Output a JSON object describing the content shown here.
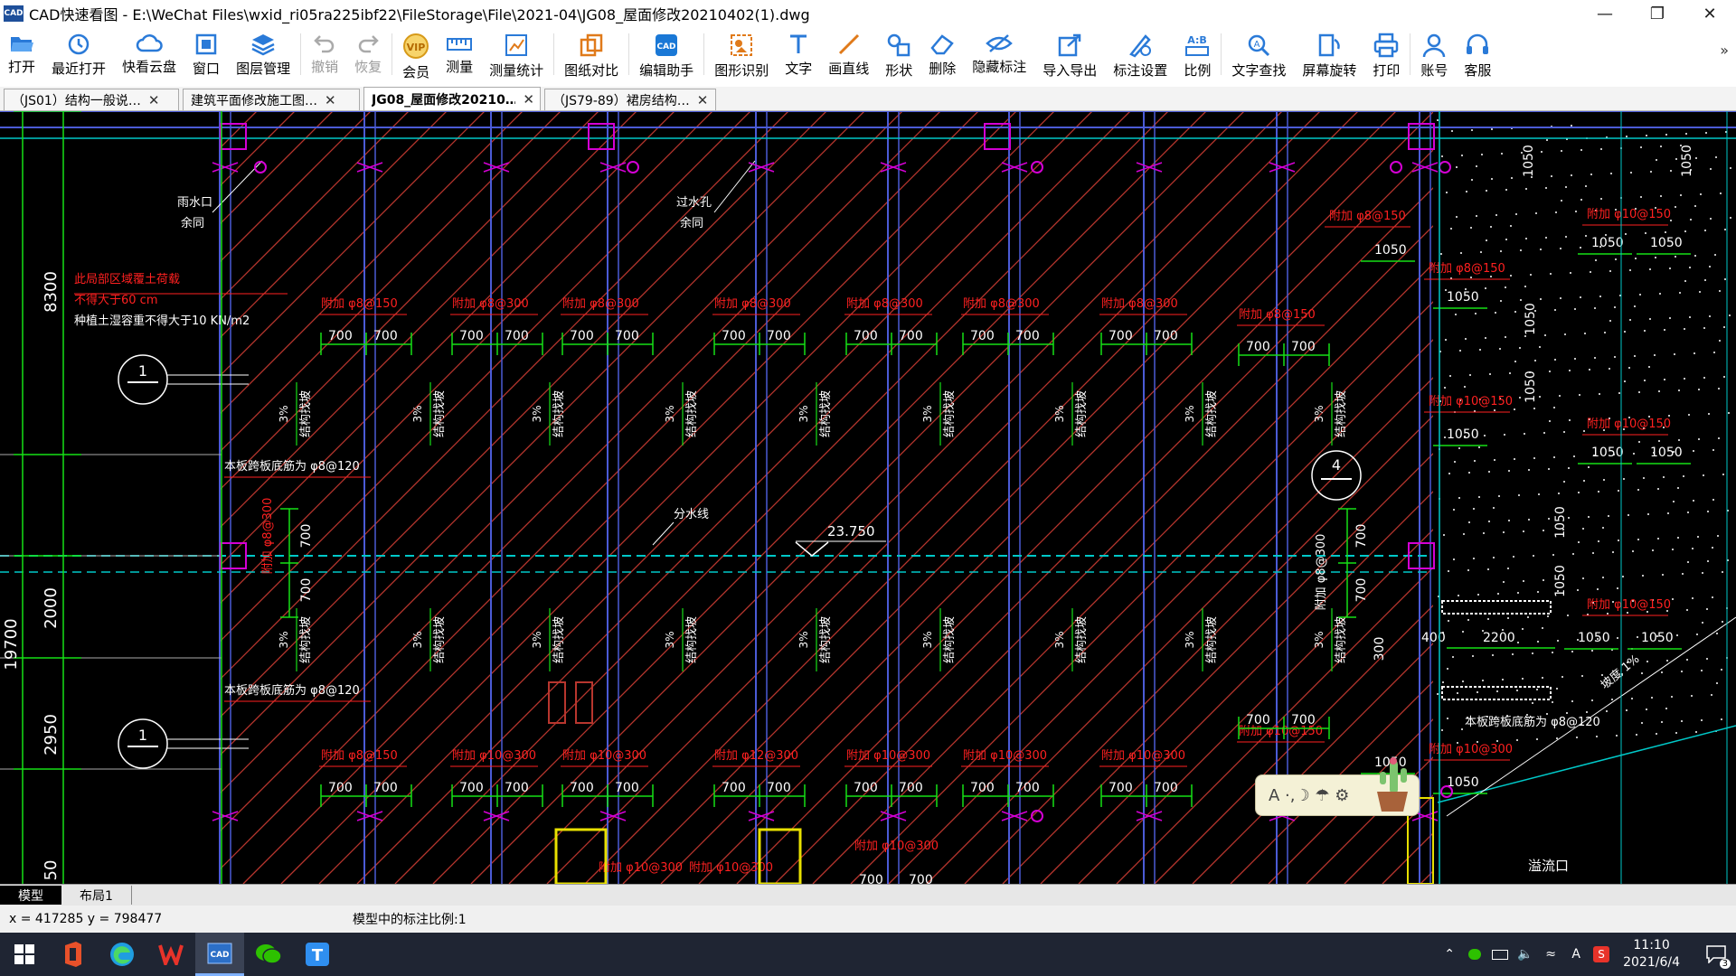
{
  "window": {
    "title": "CAD快速看图 - E:\\WeChat Files\\wxid_ri05ra225ibf22\\FileStorage\\File\\2021-04\\JG08_屋面修改20210402(1).dwg",
    "app_icon": "CAD"
  },
  "toolbar": {
    "items": [
      {
        "label": "打开",
        "icon": "folder-open-icon"
      },
      {
        "label": "最近打开",
        "icon": "history-icon"
      },
      {
        "label": "快看云盘",
        "icon": "cloud-icon"
      },
      {
        "label": "窗口",
        "icon": "window-icon"
      },
      {
        "label": "图层管理",
        "icon": "layers-icon"
      },
      {
        "label": "撤销",
        "icon": "undo-icon"
      },
      {
        "label": "恢复",
        "icon": "redo-icon"
      },
      {
        "label": "会员",
        "icon": "vip-icon"
      },
      {
        "label": "测量",
        "icon": "ruler-icon"
      },
      {
        "label": "测量统计",
        "icon": "measure-stats-icon"
      },
      {
        "label": "图纸对比",
        "icon": "compare-icon"
      },
      {
        "label": "编辑助手",
        "icon": "edit-assistant-icon"
      },
      {
        "label": "图形识别",
        "icon": "shape-recognize-icon"
      },
      {
        "label": "文字",
        "icon": "text-icon"
      },
      {
        "label": "画直线",
        "icon": "line-icon"
      },
      {
        "label": "形状",
        "icon": "shape-icon"
      },
      {
        "label": "删除",
        "icon": "eraser-icon"
      },
      {
        "label": "隐藏标注",
        "icon": "hide-annotation-icon"
      },
      {
        "label": "导入导出",
        "icon": "import-export-icon"
      },
      {
        "label": "标注设置",
        "icon": "annotation-settings-icon"
      },
      {
        "label": "比例",
        "icon": "scale-icon"
      },
      {
        "label": "文字查找",
        "icon": "text-search-icon"
      },
      {
        "label": "屏幕旋转",
        "icon": "rotate-screen-icon"
      },
      {
        "label": "打印",
        "icon": "printer-icon"
      },
      {
        "label": "账号",
        "icon": "account-icon"
      },
      {
        "label": "客服",
        "icon": "headset-icon"
      }
    ],
    "more": "»"
  },
  "tabs": [
    {
      "label": "（JS01）结构一般说…",
      "active": false
    },
    {
      "label": "建筑平面修改施工图…",
      "active": false
    },
    {
      "label": "JG08_屋面修改20210…",
      "active": true
    },
    {
      "label": "（JS79-89）裙房结构…",
      "active": false
    }
  ],
  "drawing": {
    "left_dims": [
      "8300",
      "2000",
      "2950",
      "50"
    ],
    "left_total": "19700",
    "section_mark": "1",
    "right_section_mark": "4",
    "elevation": "23.750",
    "notes": {
      "rain_outlet": [
        "雨水口",
        "余同"
      ],
      "overflow": [
        "过水孔",
        "余同"
      ],
      "load_note_1": "此局部区域覆土荷载",
      "load_note_2": "不得大于60 cm",
      "load_note_3": "种植土湿容重不得大于10 KN/m2",
      "slab_bottom": "本板跨板底筋为 φ8@120",
      "water_line": "分水线",
      "overflow_outlet": "溢流口",
      "slope": "坡度 1%"
    },
    "rebar_labels_top": [
      "附加 φ8@150",
      "附加 φ8@300",
      "附加 φ8@300",
      "附加 φ8@300",
      "附加 φ8@300",
      "附加 φ8@300",
      "附加 φ8@300"
    ],
    "rebar_labels_bottom": [
      "附加 φ8@150",
      "附加 φ10@300",
      "附加 φ10@300",
      "附加 φ12@300",
      "附加 φ10@300",
      "附加 φ10@300",
      "附加 φ10@300"
    ],
    "bottom_extra": [
      "附加 φ10@300",
      "附加 φ10@300",
      "附加 φ10@300"
    ],
    "right_rebar": [
      "附加 φ8@150",
      "附加 φ8@150",
      "附加 φ10@150",
      "附加 φ8@150",
      "附加 φ10@150",
      "附加 φ10@150",
      "附加 φ10@150",
      "附加 φ10@150"
    ],
    "dim_700": "700",
    "dim_1050": "1050",
    "dim_2200": "2200",
    "dim_400": "400",
    "dim_300": "300",
    "slope_label": "3%",
    "slope_text": "结构找坡",
    "left_rebar_vertical": "附加 φ8@300",
    "right_rebar_vertical": "附加 φ8@300"
  },
  "widget": {
    "text": "A ·,☽ ☂ ⚙"
  },
  "layout_tabs": [
    "模型",
    "布局1"
  ],
  "status": {
    "coords": "x = 417285  y = 798477",
    "scale_text": "模型中的标注比例:1"
  },
  "taskbar": {
    "apps": [
      "windows-start-icon",
      "office-icon",
      "edge-icon",
      "wps-icon",
      "cad-icon",
      "wechat-icon",
      "tencent-t-icon"
    ],
    "time": "11:10",
    "date": "2021/6/4",
    "tray_a": "A",
    "notification_count": "3"
  },
  "colors": {
    "cad_bg": "#000000",
    "grid_blue": "#4b5bd6",
    "hatch_red": "#b8362e",
    "dim_green": "#16e016",
    "rebar_red": "#ff2020",
    "text_white": "#ffffff",
    "magenta": "#d400d4",
    "cyan": "#00c8c8",
    "yellow": "#e8e000"
  }
}
